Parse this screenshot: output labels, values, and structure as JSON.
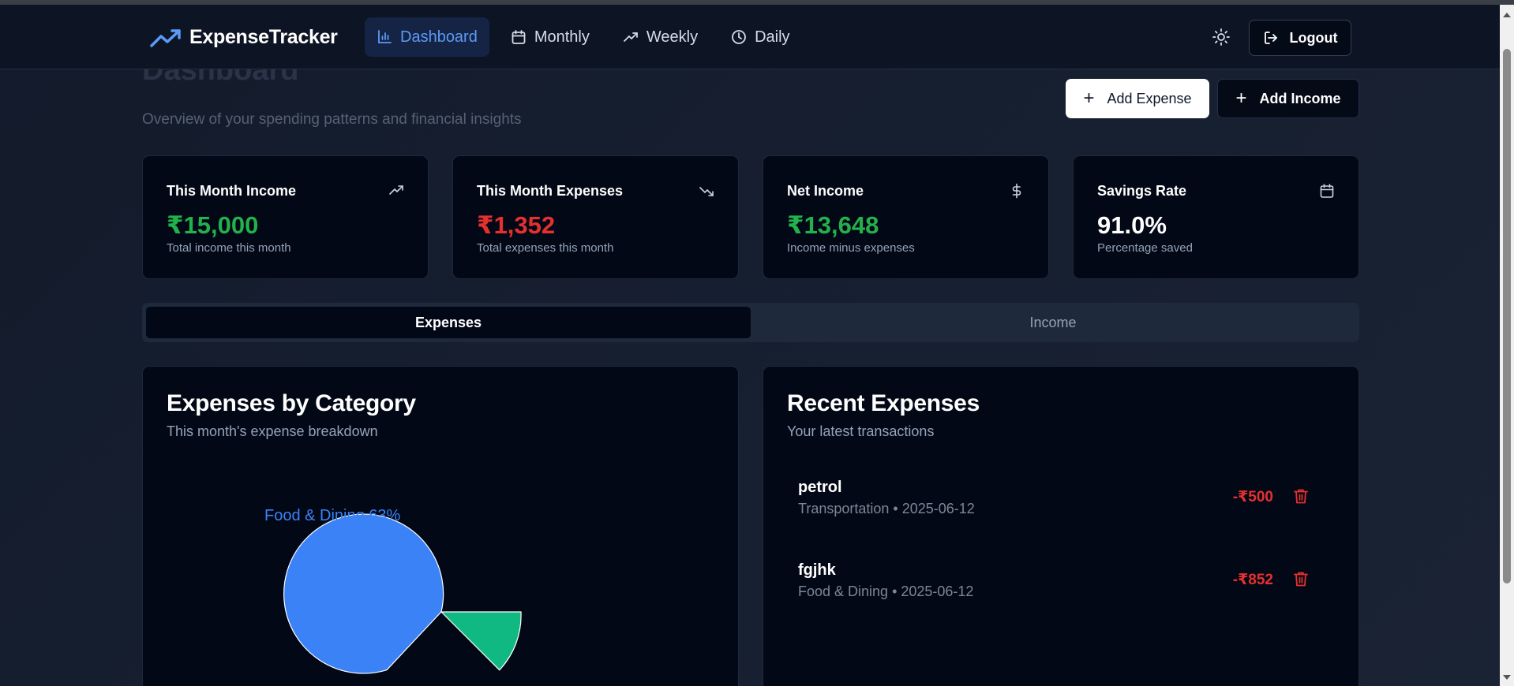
{
  "app": {
    "name": "ExpenseTracker"
  },
  "nav": {
    "items": [
      {
        "label": "Dashboard",
        "active": true,
        "icon": "bar-chart-icon"
      },
      {
        "label": "Monthly",
        "icon": "calendar-icon"
      },
      {
        "label": "Weekly",
        "icon": "trending-up-icon"
      },
      {
        "label": "Daily",
        "icon": "clock-icon"
      }
    ],
    "theme_icon": "sun-icon",
    "logout_label": "Logout"
  },
  "page": {
    "title": "Dashboard",
    "subtitle": "Overview of your spending patterns and financial insights",
    "add_expense_label": "Add Expense",
    "add_income_label": "Add Income"
  },
  "stats": [
    {
      "title": "This Month Income",
      "value": "₹15,000",
      "desc": "Total income this month",
      "icon": "trending-up-icon",
      "color": "#22b14c"
    },
    {
      "title": "This Month Expenses",
      "value": "₹1,352",
      "desc": "Total expenses this month",
      "icon": "trending-down-icon",
      "color": "#e5302f"
    },
    {
      "title": "Net Income",
      "value": "₹13,648",
      "desc": "Income minus expenses",
      "icon": "dollar-icon",
      "color": "#22b14c"
    },
    {
      "title": "Savings Rate",
      "value": "91.0%",
      "desc": "Percentage saved",
      "icon": "calendar-icon",
      "color": "#ffffff"
    }
  ],
  "tabs": [
    {
      "label": "Expenses",
      "active": true
    },
    {
      "label": "Income",
      "active": false
    }
  ],
  "category_panel": {
    "title": "Expenses by Category",
    "subtitle": "This month's expense breakdown",
    "pie_label": "Food & Dining 63%"
  },
  "chart_data": {
    "type": "pie",
    "categories": [
      "Food & Dining",
      "Transportation"
    ],
    "values": [
      852,
      500
    ],
    "colors": [
      "#3b82f6",
      "#10b981"
    ]
  },
  "recent_panel": {
    "title": "Recent Expenses",
    "subtitle": "Your latest transactions",
    "transactions": [
      {
        "name": "petrol",
        "meta": "Transportation • 2025-06-12",
        "amount": "-₹500"
      },
      {
        "name": "fgjhk",
        "meta": "Food & Dining • 2025-06-12",
        "amount": "-₹852"
      }
    ]
  }
}
